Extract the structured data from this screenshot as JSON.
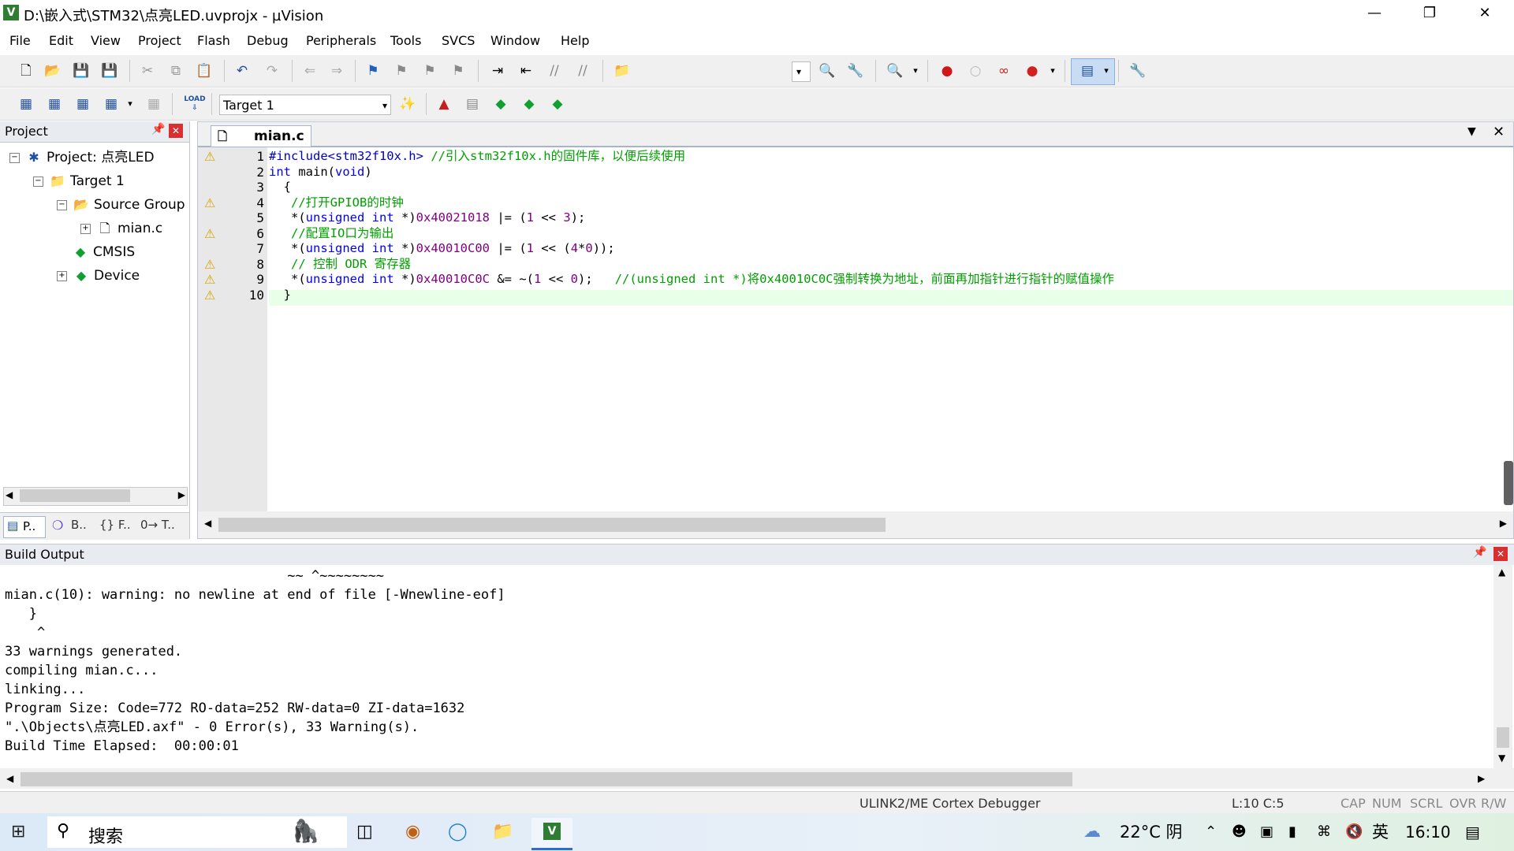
{
  "window": {
    "title": "D:\\嵌入式\\STM32\\点亮LED.uvprojx - µVision",
    "app_icon": "V"
  },
  "menu": [
    "File",
    "Edit",
    "View",
    "Project",
    "Flash",
    "Debug",
    "Peripherals",
    "Tools",
    "SVCS",
    "Window",
    "Help"
  ],
  "toolbar": {
    "target": "Target 1",
    "load_label": "LOAD"
  },
  "project": {
    "header": "Project",
    "tree": {
      "project": "Project: 点亮LED",
      "target": "Target 1",
      "group": "Source Group",
      "file": "mian.c",
      "cmsis": "CMSIS",
      "device": "Device"
    },
    "tabs": [
      "P..",
      "B..",
      "{} F..",
      "0→ T.."
    ]
  },
  "editor": {
    "tab": "mian.c",
    "warning_lines": [
      1,
      4,
      6,
      8,
      9,
      10
    ],
    "lines": [
      {
        "n": "1",
        "text": "#include<stm32f10x.h> //引入stm32f10x.h的固件库，以便后续使用"
      },
      {
        "n": "2",
        "text": "int main(void)"
      },
      {
        "n": "3",
        "text": "  {"
      },
      {
        "n": "4",
        "text": "   //打开GPIOB的时钟"
      },
      {
        "n": "5",
        "text": "   *(unsigned int *)0x40021018 |= (1 << 3);"
      },
      {
        "n": "6",
        "text": "   //配置IO口为输出"
      },
      {
        "n": "7",
        "text": "   *(unsigned int *)0x40010C00 |= (1 << (4*0));"
      },
      {
        "n": "8",
        "text": "   // 控制 ODR 寄存器"
      },
      {
        "n": "9",
        "text": "   *(unsigned int *)0x40010C0C &= ~(1 << 0);   //(unsigned int *)将0x40010C0C强制转换为地址，前面再加指针进行指针的赋值操作"
      },
      {
        "n": "10",
        "text": "  }"
      }
    ]
  },
  "build": {
    "header": "Build Output",
    "lines": [
      "                                   ~~ ^~~~~~~~~",
      "mian.c(10): warning: no newline at end of file [-Wnewline-eof]",
      "   }",
      "    ^",
      "33 warnings generated.",
      "compiling mian.c...",
      "linking...",
      "Program Size: Code=772 RO-data=252 RW-data=0 ZI-data=1632",
      "\".\\Objects\\点亮LED.axf\" - 0 Error(s), 33 Warning(s).",
      "Build Time Elapsed:  00:00:01"
    ]
  },
  "status": {
    "debugger": "ULINK2/ME Cortex Debugger",
    "position": "L:10 C:5",
    "flags": [
      "CAP",
      "NUM",
      "SCRL",
      "OVR",
      "R/W"
    ]
  },
  "taskbar": {
    "search": "搜索",
    "weather": "22°C 阴",
    "ime": "英",
    "time": "16:10"
  }
}
